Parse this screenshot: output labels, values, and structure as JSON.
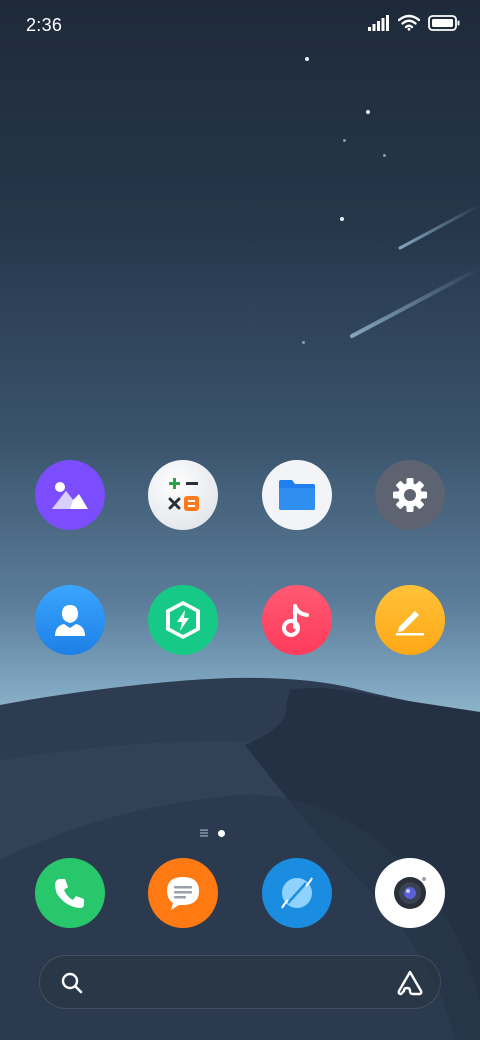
{
  "status_bar": {
    "time": "2:36",
    "icons": [
      "signal-icon",
      "wifi-icon",
      "battery-icon"
    ]
  },
  "home": {
    "grid_rows": [
      [
        {
          "name": "gallery",
          "icon": "gallery-icon",
          "color": "#7b4dff"
        },
        {
          "name": "calculator",
          "icon": "calculator-icon",
          "color": "#e9ebef"
        },
        {
          "name": "file-manager",
          "icon": "folder-icon",
          "color": "#f2f4f7"
        },
        {
          "name": "settings",
          "icon": "gear-icon",
          "color": "#5d6370"
        }
      ],
      [
        {
          "name": "contacts",
          "icon": "contact-icon",
          "color": "#2f8ef0"
        },
        {
          "name": "phone-manager",
          "icon": "shield-bolt-icon",
          "color": "#16c987"
        },
        {
          "name": "music",
          "icon": "music-note-icon",
          "color": "#ff4b6e"
        },
        {
          "name": "notes",
          "icon": "pencil-icon",
          "color": "#ffb020"
        }
      ]
    ],
    "page_indicator": {
      "pages": 2,
      "current": 2
    }
  },
  "dock": [
    {
      "name": "phone",
      "icon": "phone-icon",
      "color": "#28c76b"
    },
    {
      "name": "messages",
      "icon": "message-icon",
      "color": "#ff7a12"
    },
    {
      "name": "browser",
      "icon": "globe-icon",
      "color": "#1a8de0"
    },
    {
      "name": "camera",
      "icon": "camera-icon",
      "color": "#ffffff"
    }
  ],
  "search_bar": {
    "placeholder": "",
    "icon_left": "search-icon",
    "icon_right": "assistant-icon"
  }
}
